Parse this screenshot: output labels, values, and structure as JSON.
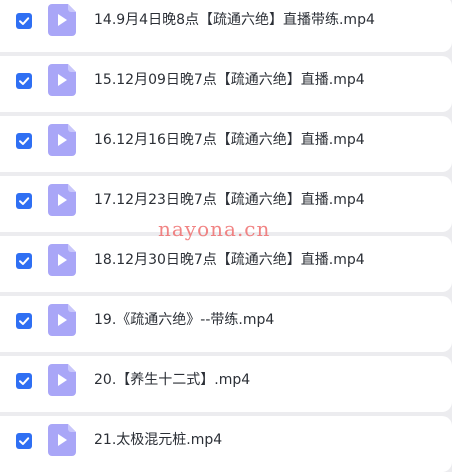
{
  "files": [
    {
      "name": "14.9月4日晚8点【疏通六绝】直播带练.mp4",
      "checked": true,
      "icon": "video-file-icon"
    },
    {
      "name": "15.12月09日晚7点【疏通六绝】直播.mp4",
      "checked": true,
      "icon": "video-file-icon"
    },
    {
      "name": "16.12月16日晚7点【疏通六绝】直播.mp4",
      "checked": true,
      "icon": "video-file-icon"
    },
    {
      "name": "17.12月23日晚7点【疏通六绝】直播.mp4",
      "checked": true,
      "icon": "video-file-icon"
    },
    {
      "name": "18.12月30日晚7点【疏通六绝】直播.mp4",
      "checked": true,
      "icon": "video-file-icon"
    },
    {
      "name": "19.《疏通六绝》--带练.mp4",
      "checked": true,
      "icon": "video-file-icon"
    },
    {
      "name": "20.【养生十二式】.mp4",
      "checked": true,
      "icon": "video-file-icon"
    },
    {
      "name": "21.太极混元桩.mp4",
      "checked": true,
      "icon": "video-file-icon"
    }
  ],
  "watermark": "nayona.cn",
  "colors": {
    "background": "#ececef",
    "row": "#ffffff",
    "checkbox": "#2f6ff3",
    "icon_fill": "#a9a6f7",
    "icon_fold": "#c9c7fb",
    "text": "#2b2f36",
    "watermark": "#ef6f6f"
  }
}
